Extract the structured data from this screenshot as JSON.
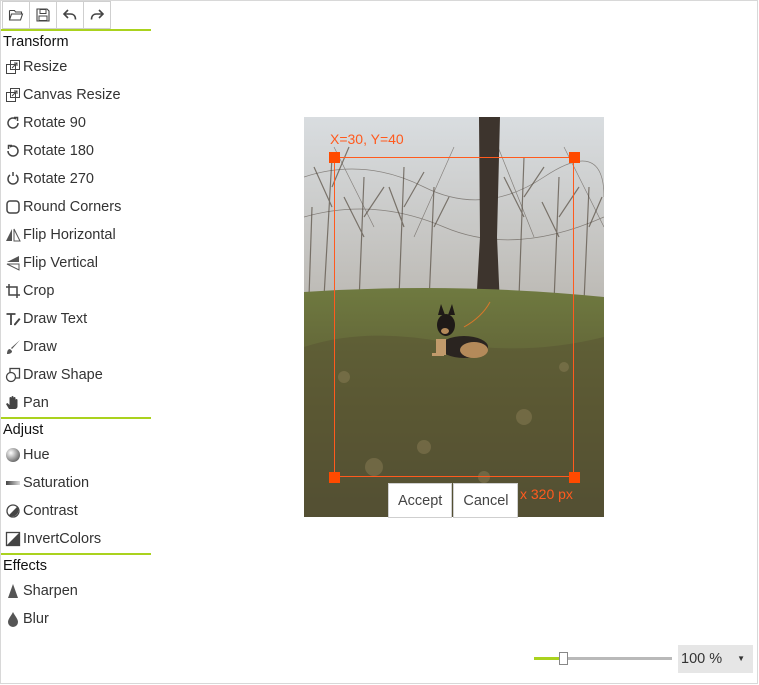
{
  "toolbar": {
    "buttons": [
      {
        "name": "open-button",
        "icon": "folder-open-icon"
      },
      {
        "name": "save-button",
        "icon": "save-icon"
      },
      {
        "name": "undo-button",
        "icon": "undo-icon"
      },
      {
        "name": "redo-button",
        "icon": "redo-icon"
      }
    ]
  },
  "sidebar": {
    "transform_title": "Transform",
    "transform": [
      {
        "label": "Resize",
        "icon": "resize-icon"
      },
      {
        "label": "Canvas Resize",
        "icon": "canvas-resize-icon"
      },
      {
        "label": "Rotate 90",
        "icon": "rotate-90-icon"
      },
      {
        "label": "Rotate 180",
        "icon": "rotate-180-icon"
      },
      {
        "label": "Rotate 270",
        "icon": "rotate-270-icon"
      },
      {
        "label": "Round Corners",
        "icon": "round-corners-icon"
      },
      {
        "label": "Flip Horizontal",
        "icon": "flip-horizontal-icon"
      },
      {
        "label": "Flip Vertical",
        "icon": "flip-vertical-icon"
      },
      {
        "label": "Crop",
        "icon": "crop-icon"
      },
      {
        "label": "Draw Text",
        "icon": "draw-text-icon"
      },
      {
        "label": "Draw",
        "icon": "brush-icon"
      },
      {
        "label": "Draw Shape",
        "icon": "draw-shape-icon"
      },
      {
        "label": "Pan",
        "icon": "hand-icon"
      }
    ],
    "adjust_title": "Adjust",
    "adjust": [
      {
        "label": "Hue",
        "icon": "hue-icon"
      },
      {
        "label": "Saturation",
        "icon": "saturation-icon"
      },
      {
        "label": "Contrast",
        "icon": "contrast-icon"
      },
      {
        "label": "InvertColors",
        "icon": "invert-colors-icon"
      }
    ],
    "effects_title": "Effects",
    "effects": [
      {
        "label": "Sharpen",
        "icon": "sharpen-icon"
      },
      {
        "label": "Blur",
        "icon": "blur-icon"
      }
    ]
  },
  "crop": {
    "coord_label": "X=30, Y=40",
    "size_label": "x 320 px",
    "accept_label": "Accept",
    "cancel_label": "Cancel"
  },
  "zoom": {
    "value_label": "100 %",
    "level_fraction": 0.21
  },
  "colors": {
    "accent": "#aad21e",
    "crop": "#ff4a00"
  }
}
